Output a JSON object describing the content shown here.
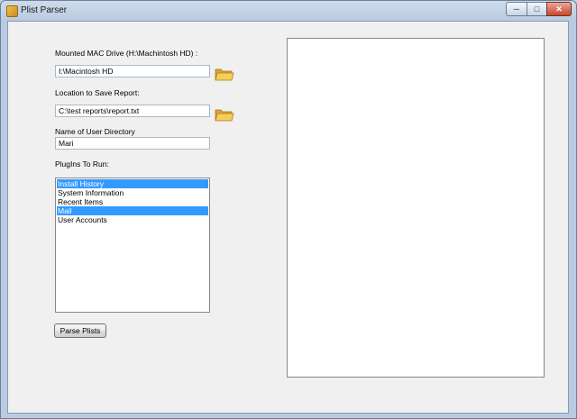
{
  "window": {
    "title": "Plist Parser"
  },
  "form": {
    "mounted_drive_label": "Mounted MAC Drive (H:\\Machintosh HD) :",
    "mounted_drive_value": "I:\\Macintosh HD",
    "save_report_label": "Location to Save Report:",
    "save_report_value": "C:\\test reports\\report.txt",
    "user_dir_label": "Name of User Directory",
    "user_dir_value": "Mari",
    "plugins_label": "PlugIns To Run:",
    "plugins": [
      {
        "label": "Install History",
        "selected": true
      },
      {
        "label": "System Information",
        "selected": false
      },
      {
        "label": "Recent Items",
        "selected": false
      },
      {
        "label": "Mail",
        "selected": true
      },
      {
        "label": "User Accounts",
        "selected": false
      }
    ],
    "parse_button": "Parse Plists"
  },
  "icons": {
    "mounted_drive_browse": "folder-icon",
    "save_report_browse": "folder-icon"
  },
  "colors": {
    "selection": "#3399ff",
    "client_bg": "#f0f0f0",
    "folder": "#f2c24c"
  }
}
